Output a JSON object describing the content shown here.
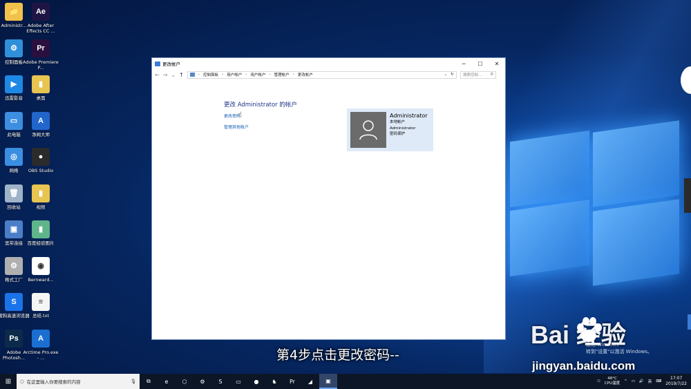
{
  "desktop": {
    "icons": [
      {
        "label": "Administr...",
        "glyph": "📁",
        "color": "#f0c14b"
      },
      {
        "label": "Adobe After Effects CC ...",
        "glyph": "Ae",
        "color": "#1f1545"
      },
      {
        "label": "控制面板",
        "glyph": "⚙",
        "color": "#2f8fd8"
      },
      {
        "label": "Adobe Premiere P...",
        "glyph": "Pr",
        "color": "#2a0f3f"
      },
      {
        "label": "迅雷影音",
        "glyph": "▶",
        "color": "#1e88e5"
      },
      {
        "label": "桌面",
        "glyph": "▮",
        "color": "#e8c450"
      },
      {
        "label": "此电脑",
        "glyph": "▭",
        "color": "#3c8ee0"
      },
      {
        "label": "净网大师",
        "glyph": "A",
        "color": "#2266cc"
      },
      {
        "label": "网络",
        "glyph": "◎",
        "color": "#3b8fe0"
      },
      {
        "label": "OBS Studio",
        "glyph": "●",
        "color": "#2b2b2b"
      },
      {
        "label": "回收站",
        "glyph": "🗑",
        "color": "#9fb3c8"
      },
      {
        "label": "视频",
        "glyph": "▮",
        "color": "#e8c450"
      },
      {
        "label": "宽带连接",
        "glyph": "▣",
        "color": "#4a7fc8"
      },
      {
        "label": "百度经验图片",
        "glyph": "▮",
        "color": "#5fb58a"
      },
      {
        "label": "格式工厂",
        "glyph": "⚙",
        "color": "#b0b0b0"
      },
      {
        "label": "Bernward...",
        "glyph": "◉",
        "color": "#ffffff"
      },
      {
        "label": "搜狗高速浏览器",
        "glyph": "S",
        "color": "#1a73e8"
      },
      {
        "label": "总结.txt",
        "glyph": "≡",
        "color": "#f5f5f5"
      },
      {
        "label": "Adobe Photosh...",
        "glyph": "Ps",
        "color": "#0d2a4a"
      },
      {
        "label": "Arctime Pro.exe - ...",
        "glyph": "A",
        "color": "#1b6fd0"
      }
    ]
  },
  "window": {
    "title": "更改帐户",
    "controls": {
      "minimize": "─",
      "maximize": "☐",
      "close": "✕"
    },
    "nav": {
      "back": "←",
      "forward": "→",
      "recent": "⌄",
      "up": "↑"
    },
    "breadcrumb": [
      "控制面板",
      "用户帐户",
      "用户帐户",
      "管理帐户",
      "更改帐户"
    ],
    "refresh": "↻",
    "search_placeholder": "搜索控制...",
    "page_title": "更改 Administrator 的帐户",
    "links": [
      "更改密码",
      "管理其他帐户"
    ],
    "account": {
      "name": "Administrator",
      "type": "本地帐户",
      "group": "Administrator",
      "status": "密码保护"
    }
  },
  "overlay": {
    "caption": "第4步点击更改密码--",
    "activate_line1": "激活 Windows",
    "activate_line2": "转到\"设置\"以激活 Windows。",
    "watermark_logo": "Bai  经验",
    "watermark_url": "jingyan.baidu.com"
  },
  "taskbar": {
    "search_placeholder": "在这里输入你要搜索的内容",
    "apps": [
      "⧉",
      "e",
      "⬡",
      "⚙",
      "S",
      "▭",
      "●",
      "♞",
      "Pr",
      "◢",
      "▣"
    ],
    "tray": {
      "temp": "48°C",
      "temp_label": "CPU温度",
      "ime": "英",
      "time": "17:07",
      "date": "2019/7/22"
    }
  }
}
